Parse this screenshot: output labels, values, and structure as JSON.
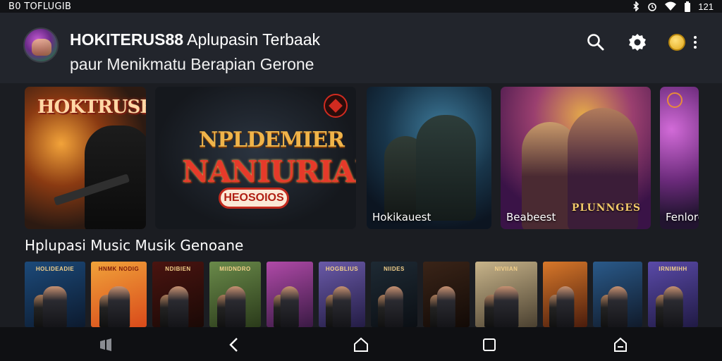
{
  "status_bar": {
    "left_text": "B0 TOFLUGIB",
    "time": "121"
  },
  "header": {
    "title_bold": "HOKITERUS88",
    "title_rest": " Aplupasin Terbaak",
    "subtitle": "paur Menikmatu Berapian Gerone",
    "icons": [
      "search-icon",
      "settings-gear-icon",
      "coin-icon",
      "more-vertical-icon"
    ]
  },
  "banners": [
    {
      "title": "HOKTRUSB",
      "caption": ""
    },
    {
      "title_top": "NPLDEMIER",
      "title_main": "NANIURIAD",
      "button_label": "HEOSOIOS",
      "caption": ""
    },
    {
      "caption": "Hokikauest"
    },
    {
      "caption": "Beabeest",
      "logo": "PLUNNGES"
    },
    {
      "caption": "Fenlore"
    }
  ],
  "section": {
    "title": "Hplupasi Music Musik Genoane"
  },
  "tiles": [
    {
      "title": "HOLIDEADIE",
      "colors": [
        "#1c4a7a",
        "#0c1a2e"
      ],
      "width": 86
    },
    {
      "title": "HNMK NODIG",
      "colors": [
        "#f0a23a",
        "#d94a1a"
      ],
      "width": 79
    },
    {
      "title": "NDIBIEN",
      "colors": [
        "#4a1410",
        "#1a0906"
      ],
      "width": 73
    },
    {
      "title": "MIIDNDRO",
      "colors": [
        "#6a8a4a",
        "#2a3a1a"
      ],
      "width": 73
    },
    {
      "title": "",
      "colors": [
        "#b04aa8",
        "#3a1a44"
      ],
      "width": 66
    },
    {
      "title": "HOGBLIUS",
      "colors": [
        "#6a5aa8",
        "#231c44"
      ],
      "width": 66
    },
    {
      "title": "NIIDES",
      "colors": [
        "#1e2a34",
        "#0b0f14"
      ],
      "width": 66
    },
    {
      "title": "",
      "colors": [
        "#3a2418",
        "#120a06"
      ],
      "width": 66
    },
    {
      "title": "NIVIIAN",
      "colors": [
        "#c8b48a",
        "#4a4030"
      ],
      "width": 88
    },
    {
      "title": "",
      "colors": [
        "#d8782a",
        "#4a1c0c"
      ],
      "width": 63
    },
    {
      "title": "",
      "colors": [
        "#2a5a8a",
        "#101a2a"
      ],
      "width": 70
    },
    {
      "title": "IRNIMIHH",
      "colors": [
        "#5a4aa8",
        "#201a44"
      ],
      "width": 71
    }
  ],
  "bottom_nav": [
    "recent-apps-icon",
    "back-icon",
    "home-icon",
    "overview-icon",
    "house-icon"
  ]
}
